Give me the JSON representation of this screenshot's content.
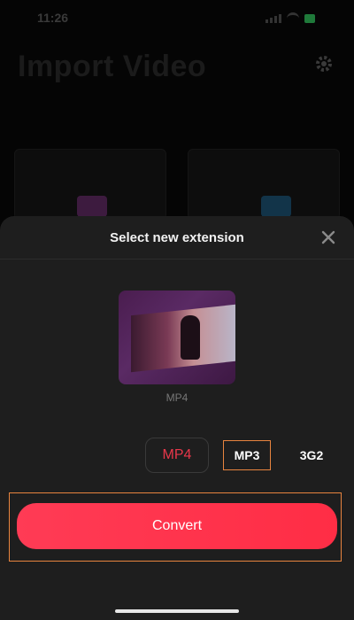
{
  "status_bar": {
    "time": "11:26"
  },
  "background": {
    "title": "Import Video"
  },
  "sheet": {
    "title": "Select new extension",
    "source_format": "MP4",
    "formats": [
      {
        "label": "MP4",
        "state": "current"
      },
      {
        "label": "MP3",
        "state": "selected"
      },
      {
        "label": "3G2",
        "state": "default"
      }
    ],
    "convert_label": "Convert"
  },
  "colors": {
    "accent": "#ff2d45",
    "highlight_outline": "#e8843f",
    "sheet_bg": "#1e1e1e"
  },
  "icons": [
    "gear-icon",
    "gallery-icon",
    "folder-icon",
    "close-icon"
  ]
}
